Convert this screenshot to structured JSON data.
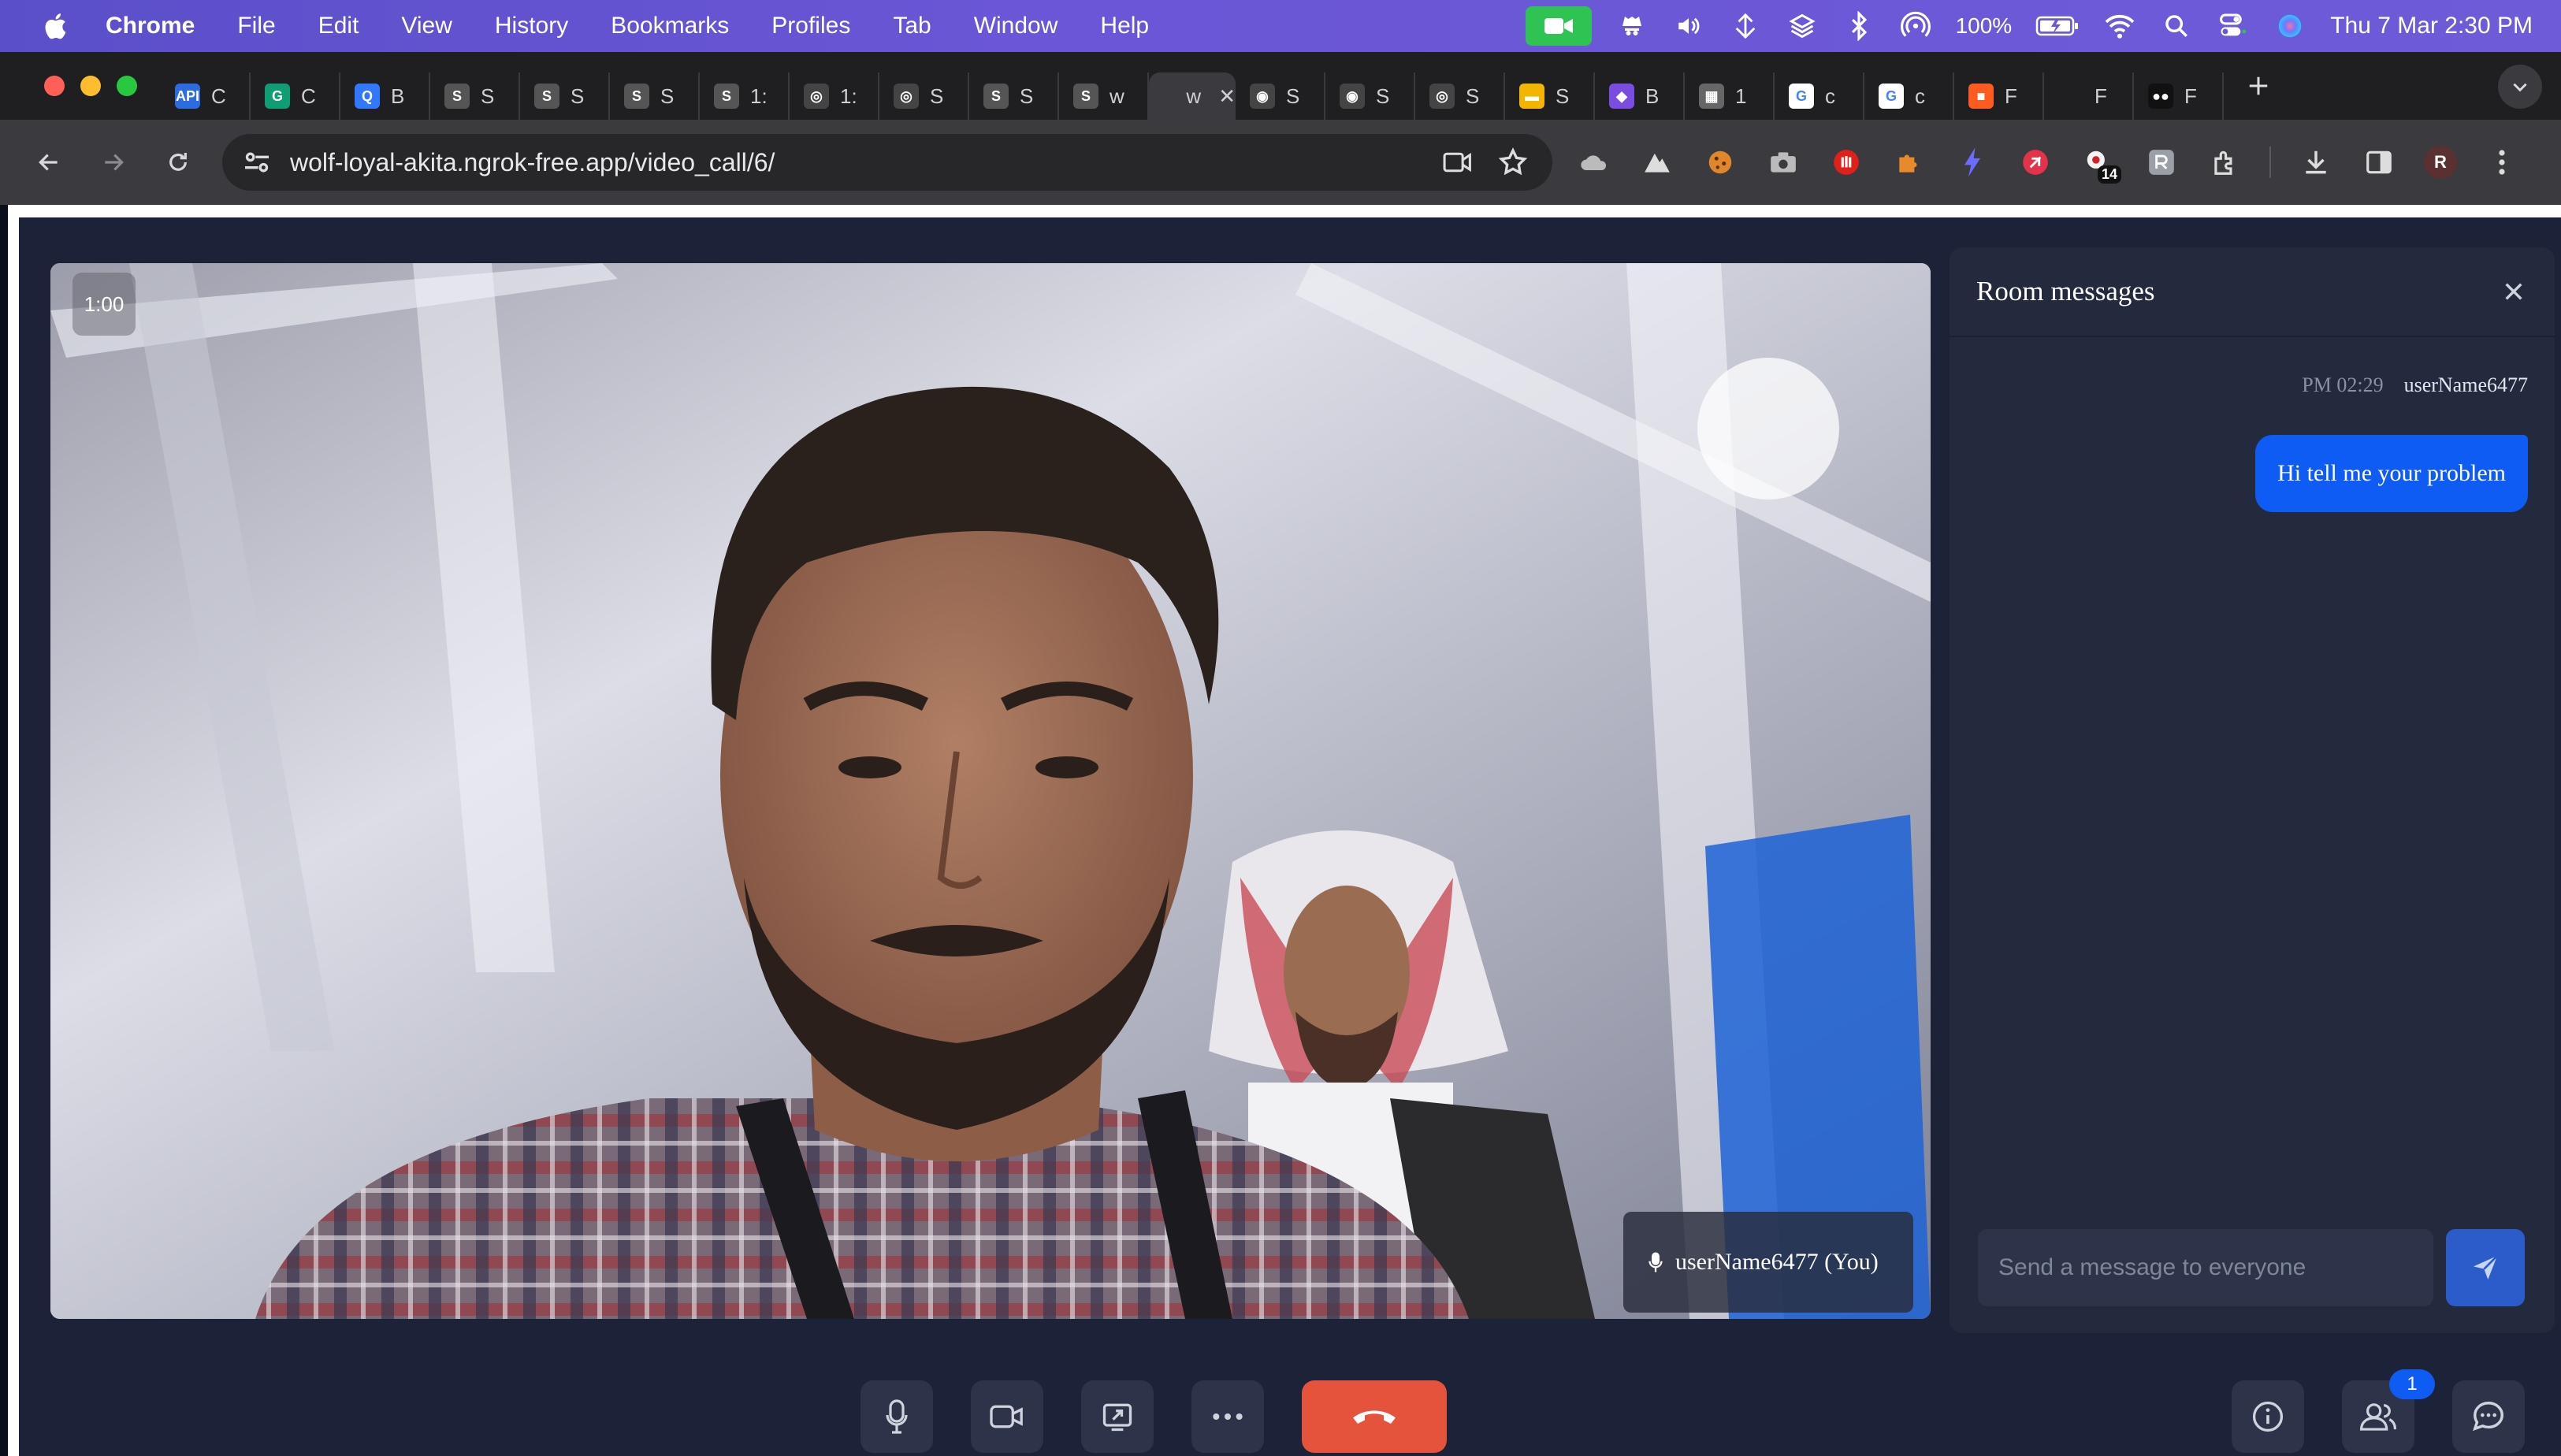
{
  "menubar": {
    "app": "Chrome",
    "menus": [
      "File",
      "Edit",
      "View",
      "History",
      "Bookmarks",
      "Profiles",
      "Tab",
      "Window",
      "Help"
    ],
    "battery": "100%",
    "clock": "Thu 7 Mar  2:30 PM"
  },
  "tabs": [
    {
      "icon": "API",
      "label": "C",
      "color": "#2d6be0"
    },
    {
      "icon": "G",
      "label": "C",
      "color": "#0f9d74"
    },
    {
      "icon": "Q",
      "label": "B",
      "color": "#3178ff"
    },
    {
      "icon": "S",
      "label": "S",
      "color": "#555"
    },
    {
      "icon": "S",
      "label": "S",
      "color": "#555"
    },
    {
      "icon": "S",
      "label": "S",
      "color": "#555"
    },
    {
      "icon": "S",
      "label": "1:",
      "color": "#555"
    },
    {
      "icon": "◎",
      "label": "1:",
      "color": "#444"
    },
    {
      "icon": "◎",
      "label": "S",
      "color": "#444"
    },
    {
      "icon": "S",
      "label": "S",
      "color": "#555"
    },
    {
      "icon": "S",
      "label": "w",
      "color": "#555"
    },
    {
      "icon": "",
      "label": "w",
      "color": "#3b3b3f",
      "active": true
    },
    {
      "icon": "◉",
      "label": "S",
      "color": "#444"
    },
    {
      "icon": "◉",
      "label": "S",
      "color": "#444"
    },
    {
      "icon": "◎",
      "label": "S",
      "color": "#444"
    },
    {
      "icon": "▬",
      "label": "S",
      "color": "#f2b600"
    },
    {
      "icon": "◆",
      "label": "B",
      "color": "#7a4ce0"
    },
    {
      "icon": "▦",
      "label": "1",
      "color": "#666"
    },
    {
      "icon": "G",
      "label": "c",
      "color": "#fff"
    },
    {
      "icon": "G",
      "label": "c",
      "color": "#fff"
    },
    {
      "icon": "■",
      "label": "F",
      "color": "#ff5a1f"
    },
    {
      "icon": "",
      "label": "F",
      "color": "#1f1f22"
    },
    {
      "icon": "●●",
      "label": "F",
      "color": "#111"
    }
  ],
  "toolbar": {
    "url": "wolf-loyal-akita.ngrok-free.app/video_call/6/",
    "ext_badge": "14",
    "profile_initial": "R"
  },
  "video": {
    "timer": "1:00",
    "participant_label": "userName6477 (You)"
  },
  "chat": {
    "title": "Room messages",
    "messages": [
      {
        "time": "PM 02:29",
        "sender": "userName6477",
        "text": "Hi tell me your problem"
      }
    ],
    "input_placeholder": "Send a message to everyone"
  },
  "controls": {
    "participants_badge": "1"
  },
  "colors": {
    "accent": "#0f5cf5",
    "end_call": "#e5533d",
    "panel": "#232a3e",
    "background": "#1c2237"
  }
}
